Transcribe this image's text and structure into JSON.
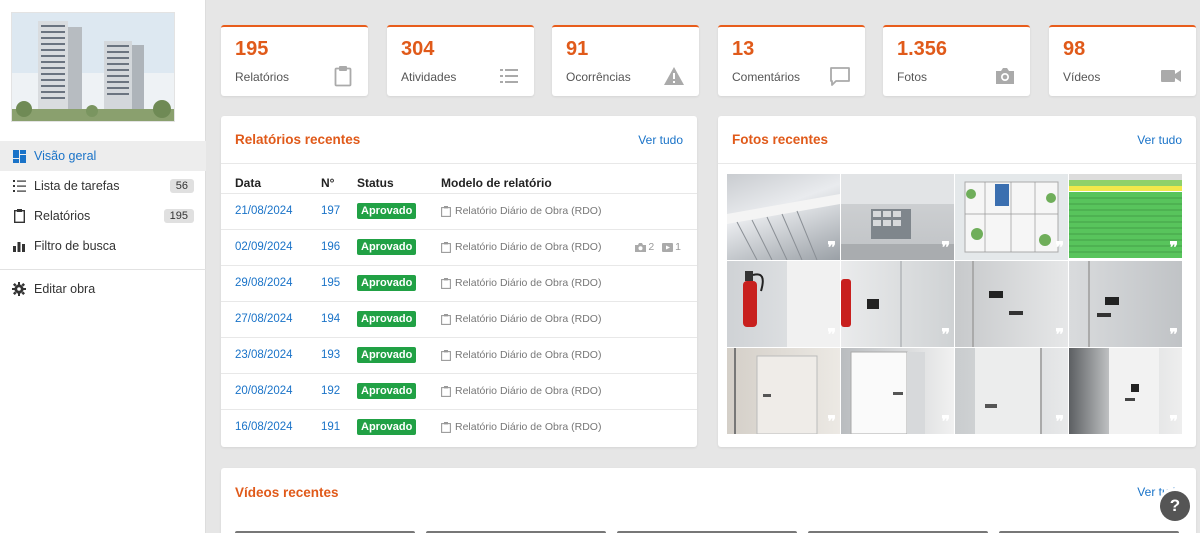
{
  "sidebar": {
    "items": [
      {
        "label": "Visão geral",
        "icon": "dashboard-icon",
        "badge": ""
      },
      {
        "label": "Lista de tarefas",
        "icon": "task-list-icon",
        "badge": "56"
      },
      {
        "label": "Relatórios",
        "icon": "clipboard-icon",
        "badge": "195"
      },
      {
        "label": "Filtro de busca",
        "icon": "bar-chart-icon",
        "badge": ""
      },
      {
        "label": "Editar obra",
        "icon": "gear-icon",
        "badge": ""
      }
    ]
  },
  "stats": [
    {
      "value": "195",
      "label": "Relatórios",
      "icon": "clipboard-icon"
    },
    {
      "value": "304",
      "label": "Atividades",
      "icon": "list-icon"
    },
    {
      "value": "91",
      "label": "Ocorrências",
      "icon": "warning-icon"
    },
    {
      "value": "13",
      "label": "Comentários",
      "icon": "comment-icon"
    },
    {
      "value": "1.356",
      "label": "Fotos",
      "icon": "camera-icon"
    },
    {
      "value": "98",
      "label": "Vídeos",
      "icon": "video-icon"
    }
  ],
  "reports": {
    "title": "Relatórios recentes",
    "link": "Ver tudo",
    "columns": {
      "date": "Data",
      "num": "N°",
      "status": "Status",
      "model": "Modelo de relatório"
    },
    "rows": [
      {
        "date": "21/08/2024",
        "num": "197",
        "status": "Aprovado",
        "model": "Relatório Diário de Obra (RDO)",
        "photos": "",
        "videos": ""
      },
      {
        "date": "02/09/2024",
        "num": "196",
        "status": "Aprovado",
        "model": "Relatório Diário de Obra (RDO)",
        "photos": "2",
        "videos": "1"
      },
      {
        "date": "29/08/2024",
        "num": "195",
        "status": "Aprovado",
        "model": "Relatório Diário de Obra (RDO)",
        "photos": "",
        "videos": ""
      },
      {
        "date": "27/08/2024",
        "num": "194",
        "status": "Aprovado",
        "model": "Relatório Diário de Obra (RDO)",
        "photos": "",
        "videos": ""
      },
      {
        "date": "23/08/2024",
        "num": "193",
        "status": "Aprovado",
        "model": "Relatório Diário de Obra (RDO)",
        "photos": "",
        "videos": ""
      },
      {
        "date": "20/08/2024",
        "num": "192",
        "status": "Aprovado",
        "model": "Relatório Diário de Obra (RDO)",
        "photos": "",
        "videos": ""
      },
      {
        "date": "16/08/2024",
        "num": "191",
        "status": "Aprovado",
        "model": "Relatório Diário de Obra (RDO)",
        "photos": "",
        "videos": ""
      }
    ]
  },
  "photos": {
    "title": "Fotos recentes",
    "link": "Ver tudo",
    "count": 12
  },
  "videos": {
    "title": "Vídeos recentes",
    "link": "Ver tudo"
  },
  "help": {
    "label": "?"
  },
  "colors": {
    "accent": "#e05a1a",
    "link": "#1a73c8",
    "approved": "#21a145"
  }
}
